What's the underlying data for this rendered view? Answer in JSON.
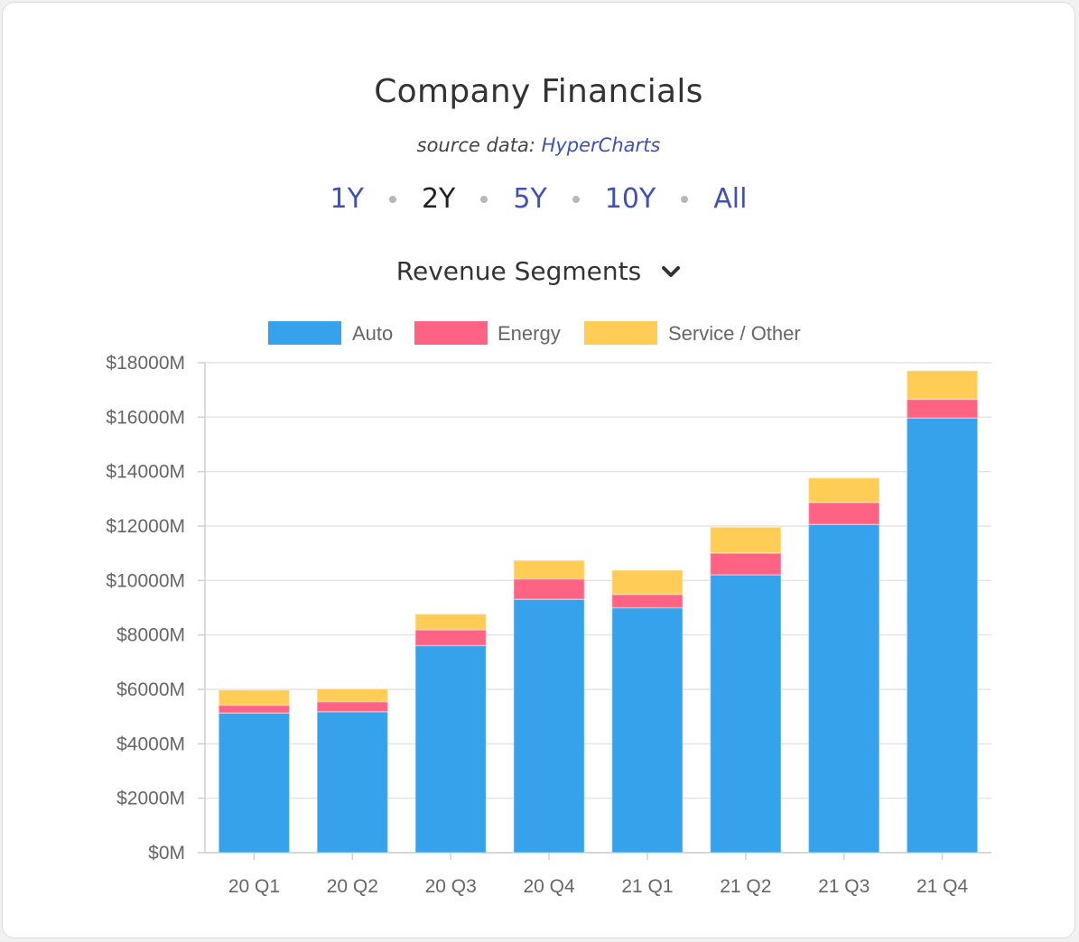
{
  "header": {
    "title": "Company Financials",
    "source_prefix": "source data:",
    "source_link": "HyperCharts"
  },
  "ranges": [
    {
      "label": "1Y",
      "active": false
    },
    {
      "label": "2Y",
      "active": true
    },
    {
      "label": "5Y",
      "active": false
    },
    {
      "label": "10Y",
      "active": false
    },
    {
      "label": "All",
      "active": false
    }
  ],
  "metric_dropdown": {
    "selected": "Revenue Segments",
    "icon": "chevron-down-icon"
  },
  "chart_data": {
    "type": "bar",
    "stacked": true,
    "categories": [
      "20 Q1",
      "20 Q2",
      "20 Q3",
      "20 Q4",
      "21 Q1",
      "21 Q2",
      "21 Q3",
      "21 Q4"
    ],
    "series": [
      {
        "name": "Auto",
        "color": "#36a2eb",
        "values": [
          5130,
          5180,
          7610,
          9310,
          9000,
          10210,
          12060,
          15970
        ]
      },
      {
        "name": "Energy",
        "color": "#ff6384",
        "values": [
          290,
          370,
          580,
          750,
          490,
          800,
          810,
          690
        ]
      },
      {
        "name": "Service / Other",
        "color": "#ffcd56",
        "values": [
          560,
          470,
          580,
          680,
          890,
          950,
          900,
          1050
        ]
      }
    ],
    "y_ticks": [
      "$0M",
      "$2000M",
      "$4000M",
      "$6000M",
      "$8000M",
      "$10000M",
      "$12000M",
      "$14000M",
      "$16000M",
      "$18000M"
    ],
    "ylim": [
      0,
      18000
    ],
    "grid": true,
    "legend_position": "top"
  }
}
